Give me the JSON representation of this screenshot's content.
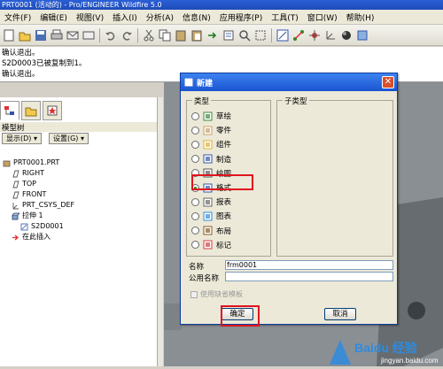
{
  "window": {
    "title": "PRT0001 (活动的) - Pro/ENGINEER Wildfire 5.0"
  },
  "menu": [
    "文件(F)",
    "编辑(E)",
    "视图(V)",
    "插入(I)",
    "分析(A)",
    "信息(N)",
    "应用程序(P)",
    "工具(T)",
    "窗口(W)",
    "帮助(H)"
  ],
  "messages": [
    "确认退出。",
    "S2D0003已被复制到1。",
    "确认退出。"
  ],
  "model_tree": {
    "title": "模型树",
    "show_btn": "显示(D) ▾",
    "settings_btn": "设置(G) ▾",
    "items": [
      {
        "label": "PRT0001.PRT",
        "indent": 0,
        "icon": "part-icon"
      },
      {
        "label": "RIGHT",
        "indent": 1,
        "icon": "datum-plane-icon"
      },
      {
        "label": "TOP",
        "indent": 1,
        "icon": "datum-plane-icon"
      },
      {
        "label": "FRONT",
        "indent": 1,
        "icon": "datum-plane-icon"
      },
      {
        "label": "PRT_CSYS_DEF",
        "indent": 1,
        "icon": "csys-icon"
      },
      {
        "label": "拉伸 1",
        "indent": 1,
        "icon": "extrude-icon"
      },
      {
        "label": "S2D0001",
        "indent": 2,
        "icon": "sketch-icon"
      },
      {
        "label": "在此插入",
        "indent": 1,
        "icon": "insert-here-icon"
      }
    ]
  },
  "dialog": {
    "title": "新建",
    "type_group_label": "类型",
    "subtype_group_label": "子类型",
    "types": [
      {
        "label": "草绘",
        "checked": false
      },
      {
        "label": "零件",
        "checked": false
      },
      {
        "label": "组件",
        "checked": false
      },
      {
        "label": "制造",
        "checked": false
      },
      {
        "label": "绘图",
        "checked": false
      },
      {
        "label": "格式",
        "checked": true
      },
      {
        "label": "报表",
        "checked": false
      },
      {
        "label": "图表",
        "checked": false
      },
      {
        "label": "布局",
        "checked": false
      },
      {
        "label": "标记",
        "checked": false
      }
    ],
    "name_label": "名称",
    "name_value": "frm0001",
    "common_name_label": "公用名称",
    "common_name_value": "",
    "use_default_template": "使用缺省模板",
    "ok_label": "确定",
    "cancel_label": "取消"
  },
  "watermark": {
    "brand": "Baidu 经验",
    "url": "jingyan.baidu.com"
  },
  "colors": {
    "highlight": "#e1141e",
    "title_blue": "#1a54d0",
    "viewport": "#8a8f93"
  }
}
